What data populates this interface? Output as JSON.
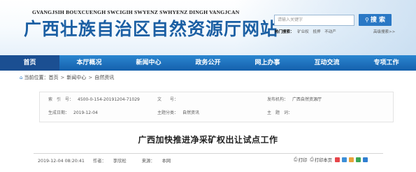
{
  "header": {
    "pinyin": "GVANGJSIH BOUXCUENGH SWCIGIH SWYENZ SWHYENZ DINGH VANGJCAN",
    "title": "广西壮族自治区自然资源厅网站",
    "title_color": "#1b5fa3"
  },
  "search": {
    "placeholder": "请输入关键字",
    "button_label": "搜 索",
    "icon": "search-icon",
    "hotwords_label": "热门搜索：",
    "hotwords": [
      "矿业权",
      "抵押",
      "不动产"
    ],
    "advanced_label": "高级搜索>>"
  },
  "nav": {
    "items": [
      "首页",
      "本厅概况",
      "新闻中心",
      "政务公开",
      "网上办事",
      "互动交流",
      "专项工作"
    ],
    "active_color": "#1b4f92",
    "bar_color": "#1560ac"
  },
  "breadcrumb": {
    "label": "当前位置：",
    "items": [
      "首页",
      "新闻中心",
      "自然资讯"
    ],
    "separator": ">"
  },
  "meta": {
    "index_label": "索　引　号：",
    "index_value": "4500-0-154-20191204-71029",
    "docno_label": "文　　号：",
    "docno_value": "",
    "publisher_label": "发布机构：",
    "publisher_value": "广西自然资源厅",
    "date_label": "生成日期：",
    "date_value": "2019-12-04",
    "category_label": "主题分类：",
    "category_value": "自然资讯",
    "topic_label": "主　题　词：",
    "topic_value": ""
  },
  "article": {
    "title": "广西加快推进净采矿权出让试点工作",
    "datetime": "2019-12-04 08:20:41",
    "author_label": "作者：",
    "author": "李欣松",
    "source_label": "来源：",
    "source": "本网"
  },
  "tools": {
    "print_label": "打印",
    "print_page_label": "打印本页",
    "share_colors": [
      "#e6454a",
      "#3c8fd8",
      "#e8a23a",
      "#3aa655",
      "#2f7fd1"
    ]
  }
}
